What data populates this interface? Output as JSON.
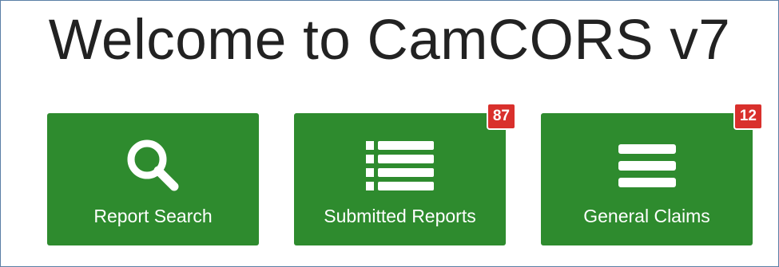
{
  "header": {
    "title": "Welcome to CamCORS v7"
  },
  "tiles": [
    {
      "label": "Report Search",
      "icon": "search-icon",
      "badge": null
    },
    {
      "label": "Submitted Reports",
      "icon": "list-icon",
      "badge": "87"
    },
    {
      "label": "General Claims",
      "icon": "menu-icon",
      "badge": "12"
    }
  ],
  "colors": {
    "tile_background": "#2e8b2e",
    "badge_background": "#d9302c",
    "title_text": "#222222"
  }
}
